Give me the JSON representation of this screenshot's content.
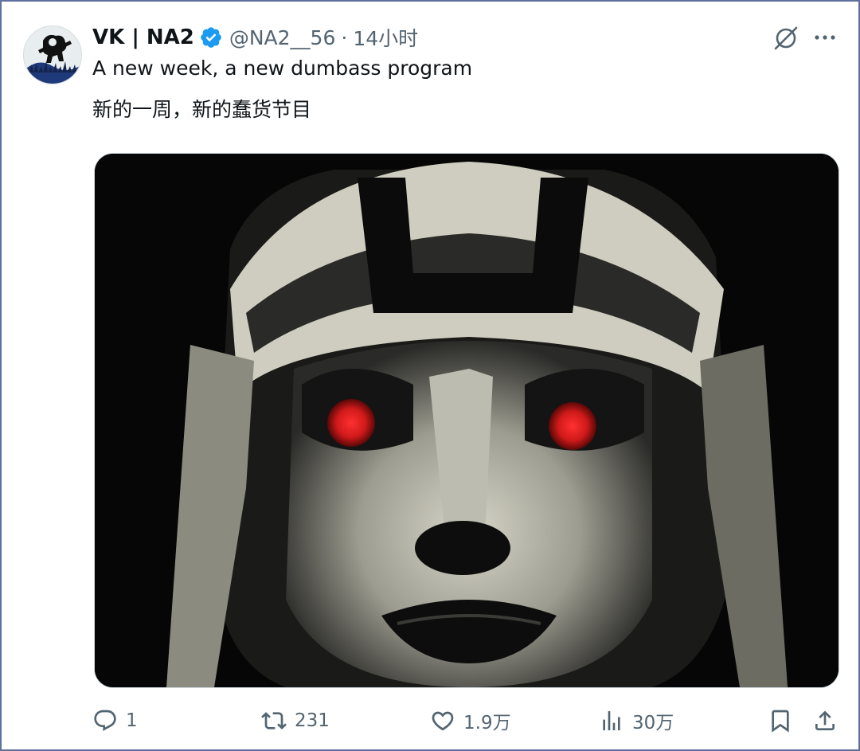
{
  "tweet": {
    "display_name": "VK | NA2",
    "handle": "@NA2__56",
    "separator": "·",
    "time": "14小时",
    "text_line1": "A new week, a new dumbass program",
    "text_line2": "新的一周，新的蠢货节目"
  },
  "stats": {
    "replies": "1",
    "retweets": "231",
    "likes": "1.9万",
    "views": "30万"
  },
  "icons": {
    "verified": "verified-badge-icon",
    "grok": "grok-icon",
    "more": "more-icon",
    "reply": "reply-icon",
    "retweet": "retweet-icon",
    "like": "heart-icon",
    "views": "views-icon",
    "bookmark": "bookmark-icon",
    "share": "share-icon"
  },
  "colors": {
    "verified": "#1d9bf0",
    "text": "#0f1419",
    "secondary": "#536471",
    "border": "#5f6f9e",
    "eye_red": "#d01a1a"
  }
}
